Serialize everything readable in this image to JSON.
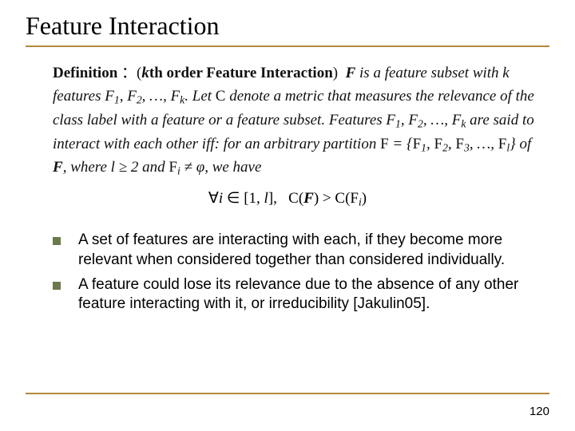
{
  "title": "Feature Interaction",
  "definition_html": "<span class='bold'>Definition</span> <span class='roman'>：</span><span class='roman'>(</span><span class='bolditalic'>k</span><span class='bold'>th order Feature Interaction</span><span class='roman'>)</span>&nbsp;&nbsp;<span class='bolditalic'>F</span> is a feature subset with k features F<sub>1</sub>, F<sub>2</sub>, …, F<sub>k</sub>. Let <span class='script'>C</span> denote a metric that measures the relevance of the class label with a feature or a feature subset. Features F<sub>1</sub>, F<sub>2</sub>, …, F<sub>k</sub> are said to interact with each other iff: for an arbitrary partition <span class='script'>F</span> = {<span class='script'>F</span><sub>1</sub>, <span class='script'>F</span><sub>2</sub>, <span class='script'>F</span><sub>3</sub>, …, <span class='script'>F</span><sub>l</sub>} of <span class='bolditalic'>F</span>, where l ≥ 2 and <span class='script'>F</span><sub>i</sub> ≠ φ, we have",
  "formula_html": "<span class='roman'>∀</span>i <span class='roman'>∈ [1,</span> l<span class='roman'>],</span>&nbsp;&nbsp;&nbsp;<span class='script'>C</span><span class='roman'>(</span><span class='bolditalic' style='font-weight:bold'>F</span><span class='roman'>)</span> <span class='roman'>&gt;</span> <span class='script'>C</span><span class='roman'>(</span><span class='script'>F</span><sub>i</sub><span class='roman'>)</span>",
  "bullets": [
    "A set of features are interacting with each, if they become more relevant when considered together than considered individually.",
    "A feature could lose its relevance due to the absence of any other feature interacting with it, or irreducibility [Jakulin05]."
  ],
  "page_number": "120"
}
